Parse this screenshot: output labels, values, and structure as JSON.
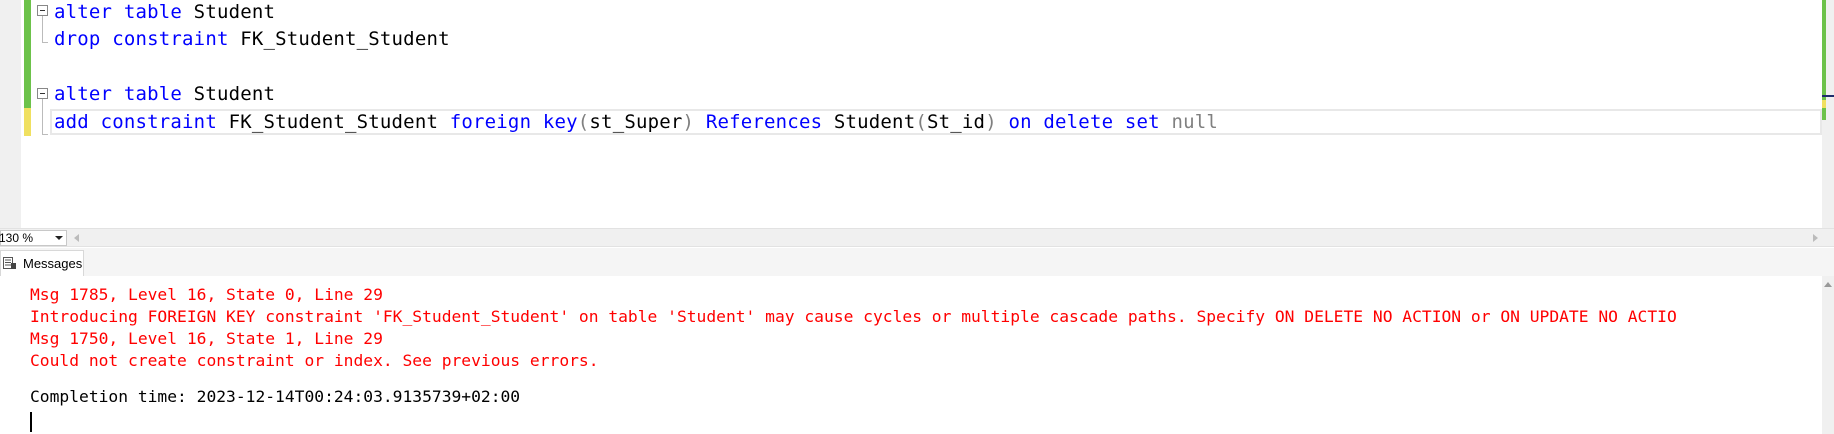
{
  "editor": {
    "lines": [
      {
        "tokens": [
          {
            "t": "alter",
            "c": "kw"
          },
          {
            "t": " "
          },
          {
            "t": "table",
            "c": "kw"
          },
          {
            "t": " Student"
          }
        ]
      },
      {
        "tokens": [
          {
            "t": "drop",
            "c": "kw"
          },
          {
            "t": " "
          },
          {
            "t": "constraint",
            "c": "kw"
          },
          {
            "t": " FK_Student_Student"
          }
        ]
      },
      {
        "tokens": []
      },
      {
        "tokens": [
          {
            "t": "alter",
            "c": "kw"
          },
          {
            "t": " "
          },
          {
            "t": "table",
            "c": "kw"
          },
          {
            "t": " Student"
          }
        ]
      },
      {
        "tokens": [
          {
            "t": "add",
            "c": "kw"
          },
          {
            "t": " "
          },
          {
            "t": "constraint",
            "c": "kw"
          },
          {
            "t": " FK_Student_Student "
          },
          {
            "t": "foreign",
            "c": "kw"
          },
          {
            "t": " "
          },
          {
            "t": "key",
            "c": "kw"
          },
          {
            "t": "(",
            "c": "gr"
          },
          {
            "t": "st_Super"
          },
          {
            "t": ")",
            "c": "gr"
          },
          {
            "t": " "
          },
          {
            "t": "References",
            "c": "kw"
          },
          {
            "t": " Student"
          },
          {
            "t": "(",
            "c": "gr"
          },
          {
            "t": "St_id"
          },
          {
            "t": ")",
            "c": "gr"
          },
          {
            "t": " "
          },
          {
            "t": "on",
            "c": "kw"
          },
          {
            "t": " "
          },
          {
            "t": "delete",
            "c": "kw"
          },
          {
            "t": " "
          },
          {
            "t": "set",
            "c": "kw"
          },
          {
            "t": " "
          },
          {
            "t": "null",
            "c": "gr"
          }
        ]
      }
    ]
  },
  "zoom": {
    "value": "130 %"
  },
  "results_tabs": [
    {
      "label": "Messages",
      "icon": "messages-icon"
    }
  ],
  "messages": [
    {
      "text": "Msg 1785, Level 16, State 0, Line 29",
      "kind": "err"
    },
    {
      "text": "Introducing FOREIGN KEY constraint 'FK_Student_Student' on table 'Student' may cause cycles or multiple cascade paths. Specify ON DELETE NO ACTION or ON UPDATE NO ACTIO",
      "kind": "err"
    },
    {
      "text": "Msg 1750, Level 16, State 1, Line 29",
      "kind": "err"
    },
    {
      "text": "Could not create constraint or index. See previous errors.",
      "kind": "err"
    },
    {
      "text": "",
      "kind": "norm"
    },
    {
      "text": "Completion time: 2023-12-14T00:24:03.9135739+02:00",
      "kind": "norm"
    }
  ],
  "colors": {
    "keyword": "#0000ff",
    "operator": "#808080",
    "error": "#ff0000",
    "saved_change": "#6cc24a",
    "unsaved_change": "#f0e060"
  }
}
